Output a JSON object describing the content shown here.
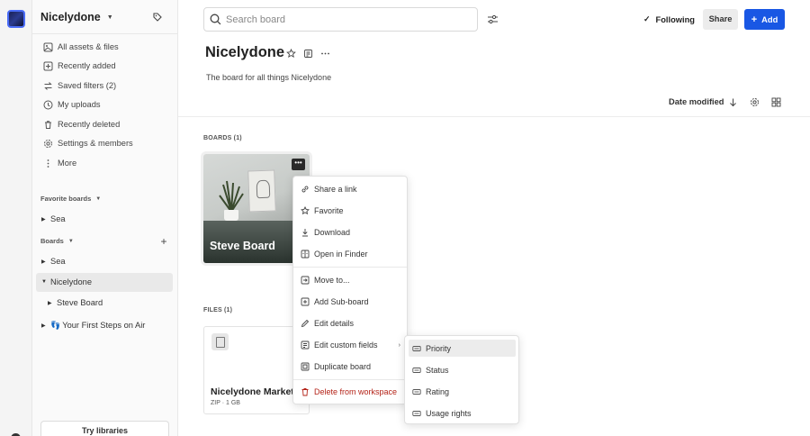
{
  "workspace": {
    "name": "Nicelydone"
  },
  "nav": [
    {
      "label": "All assets & files",
      "icon": "assets-icon"
    },
    {
      "label": "Recently added",
      "icon": "plus-square-icon"
    },
    {
      "label": "Saved filters (2)",
      "icon": "swap-icon"
    },
    {
      "label": "My uploads",
      "icon": "clock-icon"
    },
    {
      "label": "Recently deleted",
      "icon": "trash-icon"
    },
    {
      "label": "Settings & members",
      "icon": "gear-icon"
    },
    {
      "label": "More",
      "icon": "kebab-icon"
    }
  ],
  "favorite_boards": {
    "label": "Favorite boards",
    "items": [
      {
        "label": "Sea"
      }
    ]
  },
  "boards": {
    "label": "Boards",
    "items": [
      {
        "label": "Sea"
      },
      {
        "label": "Nicelydone"
      },
      {
        "label": "Steve Board"
      },
      {
        "label": "Your First Steps on Air",
        "prefix": "👣"
      }
    ]
  },
  "try_libraries": "Try libraries",
  "search": {
    "placeholder": "Search board",
    "value": ""
  },
  "header": {
    "following": "Following",
    "share": "Share",
    "add": "Add"
  },
  "board": {
    "title": "Nicelydone",
    "description": "The board for all things Nicelydone",
    "sort": "Date modified"
  },
  "sections": {
    "boards": "BOARDS (1)",
    "files": "FILES (1)"
  },
  "board_card": {
    "title": "Steve Board"
  },
  "file_card": {
    "name": "Nicelydone Marketing",
    "meta": "ZIP · 1 GB"
  },
  "context_menu": [
    {
      "label": "Share a link",
      "icon": "link-icon"
    },
    {
      "label": "Favorite",
      "icon": "star-icon"
    },
    {
      "label": "Download",
      "icon": "download-icon"
    },
    {
      "label": "Open in Finder",
      "icon": "finder-icon"
    },
    {
      "label": "Move to...",
      "icon": "move-icon"
    },
    {
      "label": "Add Sub-board",
      "icon": "sub-board-icon"
    },
    {
      "label": "Edit details",
      "icon": "pencil-icon"
    },
    {
      "label": "Edit custom fields",
      "icon": "custom-fields-icon"
    },
    {
      "label": "Duplicate board",
      "icon": "duplicate-icon"
    },
    {
      "label": "Delete from workspace",
      "icon": "trash-icon"
    }
  ],
  "submenu": [
    {
      "label": "Priority",
      "icon": "field-icon"
    },
    {
      "label": "Status",
      "icon": "field-icon"
    },
    {
      "label": "Rating",
      "icon": "field-icon"
    },
    {
      "label": "Usage rights",
      "icon": "field-icon"
    }
  ],
  "colors": {
    "primary": "#1957e4",
    "danger": "#b42318",
    "selected": "#e9e9e9"
  }
}
